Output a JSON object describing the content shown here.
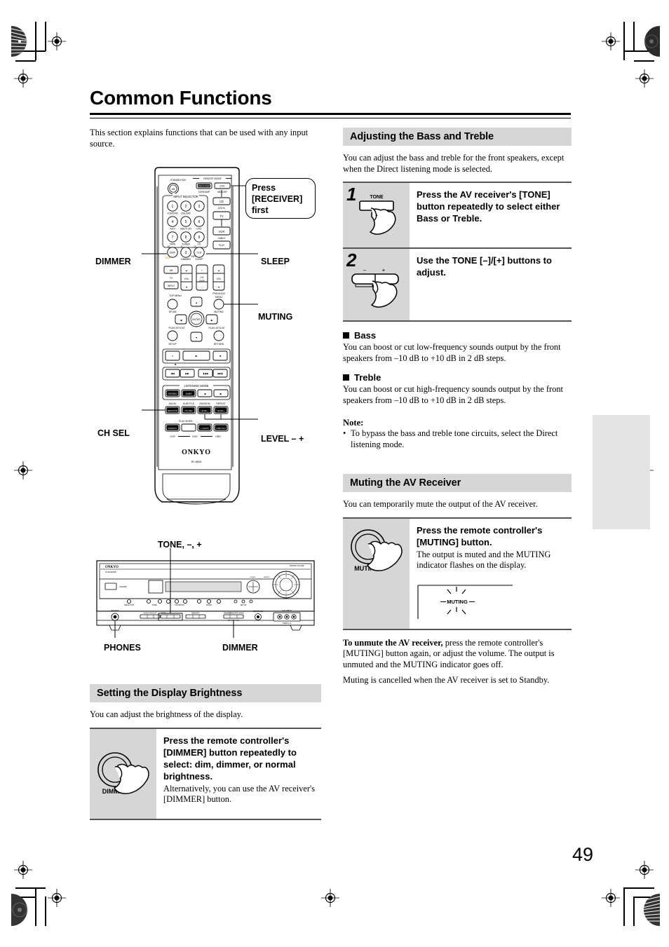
{
  "page": {
    "title": "Common Functions",
    "number": "49"
  },
  "left": {
    "intro": "This section explains functions that can be used with any input source.",
    "remote_callout": "Press [RECEIVER] first",
    "remote_labels": {
      "dimmer": "DIMMER",
      "sleep": "SLEEP",
      "muting": "MUTING",
      "ch_sel": "CH SEL",
      "level": "LEVEL – +"
    },
    "remote_face": {
      "standby": "STANDBY/ON",
      "remote_mode": "REMOTE MODE",
      "receiver_btn": "RECEIVER",
      "tape_amp": "TAPE/AMP",
      "md_cdr": "MD/CDR",
      "dock": "DOCK",
      "cable": "CABLE",
      "input_selector": "INPUT SELECTOR",
      "keys": [
        "1",
        "2",
        "3",
        "4",
        "5",
        "6",
        "7",
        "8",
        "9",
        "0"
      ],
      "key_subs": [
        "VCR/DVR",
        "CBL/SAT",
        "",
        "AUX",
        "MULTI CH",
        "DVD",
        "TAPE",
        "TUNER",
        "CD"
      ],
      "side_btns": [
        "CD",
        "TV",
        "VCR",
        "PLAY"
      ],
      "dimmer_key": "DIMMER",
      "sleep_key": "SLEEP",
      "tv": "TV",
      "vol": "VOL",
      "input": "INPUT",
      "ch": "CH",
      "top_menu": "TOP MENU",
      "previous_menu": "PREVIOUS MENU",
      "sp_ab": "SP A/B",
      "muting_key": "MUTING",
      "enter": "ENTER",
      "setup": "SETUP",
      "return": "RETURN",
      "playlist_left": "PLAYLIST/CAT",
      "playlist_right": "PLAYLIST/CAT",
      "listening_mode": "LISTENING MODE",
      "stereo": "STEREO",
      "surround": "SURROUND",
      "audio": "AUDIO",
      "subtitle": "SUBTITLE",
      "random": "RANDOM",
      "repeat": "REPEAT",
      "recpcm": "REC/PCM",
      "chsel_key": "CH SEL",
      "level_minus": "LEVEL –",
      "level_plus": "LEVEL +",
      "play_mode": "PLAY MODE",
      "display": "DISPLAY",
      "l_night": "L NIGHT",
      "dim_tun": "DIM/TUN",
      "vcr": "VCR",
      "dvd": "DVD",
      "hdd": "HDD",
      "brand": "ONKYO",
      "model": "RC-681M"
    },
    "receiver_labels": {
      "tone": "TONE, –, +",
      "phones": "PHONES",
      "dimmer": "DIMMER",
      "brand": "ONKYO"
    },
    "brightness": {
      "heading": "Setting the Display Brightness",
      "intro": "You can adjust the brightness of the display.",
      "icon_label": "DIMMER",
      "step_title": "Press the remote controller's [DIMMER] button repeatedly to select: dim, dimmer, or normal brightness.",
      "step_sub": "Alternatively, you can use the AV receiver's [DIMMER] button."
    }
  },
  "right": {
    "bass_treble": {
      "heading": "Adjusting the Bass and Treble",
      "intro": "You can adjust the bass and treble for the front speakers, except when the Direct listening mode is selected.",
      "steps": [
        {
          "num": "1",
          "fig_label": "TONE",
          "title": "Press the AV receiver's [TONE] button repeatedly to select either Bass or Treble."
        },
        {
          "num": "2",
          "fig_minus": "–",
          "fig_plus": "+",
          "title": "Use the TONE [–]/[+] buttons to adjust."
        }
      ],
      "bass_head": "Bass",
      "bass_text": "You can boost or cut low-frequency sounds output by the front speakers from –10 dB to +10 dB in 2 dB steps.",
      "treble_head": "Treble",
      "treble_text": "You can boost or cut high-frequency sounds output by the front speakers from –10 dB to +10 dB in 2 dB steps.",
      "note_head": "Note:",
      "note_bullet": "•",
      "note_text": "To bypass the bass and treble tone circuits, select the Direct listening mode."
    },
    "muting": {
      "heading": "Muting the AV Receiver",
      "intro": "You can temporarily mute the output of the AV receiver.",
      "icon_label": "MUTING",
      "step_title": "Press the remote controller's [MUTING] button.",
      "step_sub": "The output is muted and the MUTING indicator flashes on the display.",
      "display_indicator": "MUTING",
      "unmute_bold": "To unmute the AV receiver,",
      "unmute_rest": " press the remote controller's [MUTING] button again, or adjust the volume. The output is unmuted and the MUTING indicator goes off.",
      "standby_text": "Muting is cancelled when the AV receiver is set to Standby."
    }
  },
  "colors": {
    "section_bar": "#d6d6d6",
    "figure_bg": "#d6d6d6",
    "side_tab": "#e3e3e3",
    "rule": "#555555"
  }
}
